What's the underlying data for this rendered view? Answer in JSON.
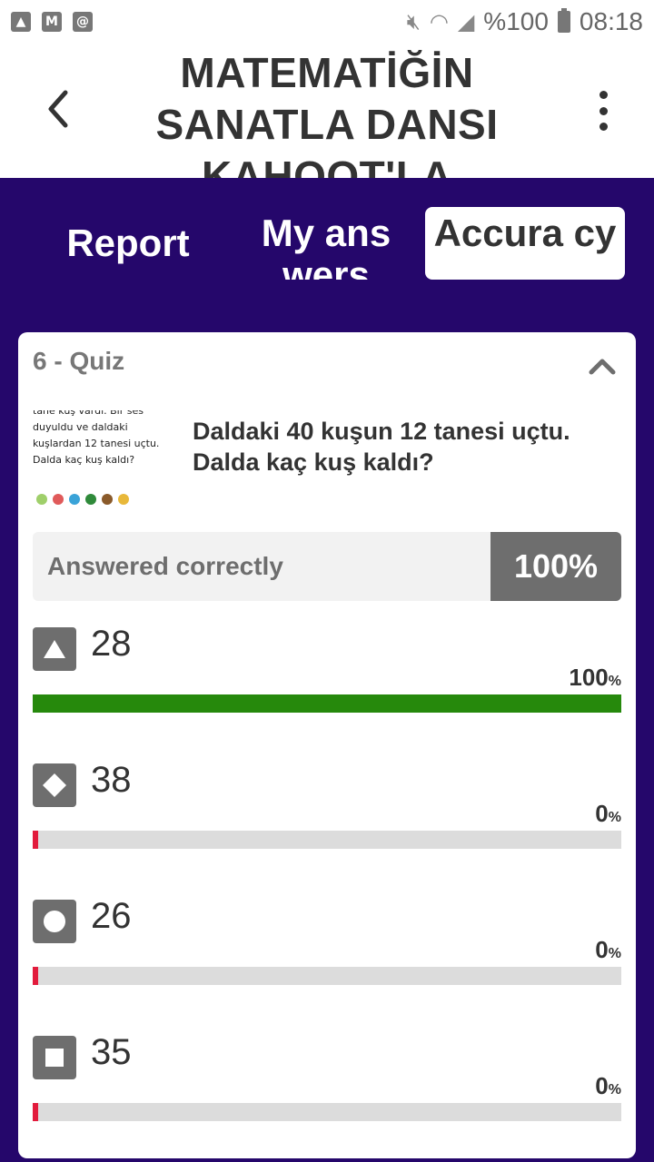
{
  "status_bar": {
    "battery_text": "%100",
    "time": "08:18"
  },
  "header": {
    "title": "MATEMATİĞİN SANATLA DANSI KAHOOT'LA"
  },
  "tabs": [
    {
      "label": "Report",
      "active": false
    },
    {
      "label": "My ans wers",
      "active": false
    },
    {
      "label": "Accura cy",
      "active": true
    }
  ],
  "question": {
    "heading": "6 - Quiz",
    "image_text": "tane kuş vardı. Bir ses duyuldu ve daldaki kuşlardan 12 tanesi uçtu. Dalda kaç kuş kaldı?",
    "text": "Daldaki 40 kuşun 12 tanesi uçtu. Dalda kaç kuş kaldı?",
    "correct_label": "Answered correctly",
    "correct_pct": "100%"
  },
  "answers": [
    {
      "shape": "triangle-icon",
      "value": "28",
      "pct_num": "100",
      "pct_sign": "%",
      "fraction": 1.0,
      "correct": true
    },
    {
      "shape": "diamond-icon",
      "value": "38",
      "pct_num": "0",
      "pct_sign": "%",
      "fraction": 0.0,
      "correct": false
    },
    {
      "shape": "circle-icon",
      "value": "26",
      "pct_num": "0",
      "pct_sign": "%",
      "fraction": 0.0,
      "correct": false
    },
    {
      "shape": "square-icon",
      "value": "35",
      "pct_num": "0",
      "pct_sign": "%",
      "fraction": 0.0,
      "correct": false
    }
  ],
  "colors": {
    "background": "#25076b",
    "correct_fill": "#26890c",
    "incorrect_marker": "#e21b3c",
    "track": "#dcdcdc",
    "icon_bg": "#6e6e6e"
  }
}
